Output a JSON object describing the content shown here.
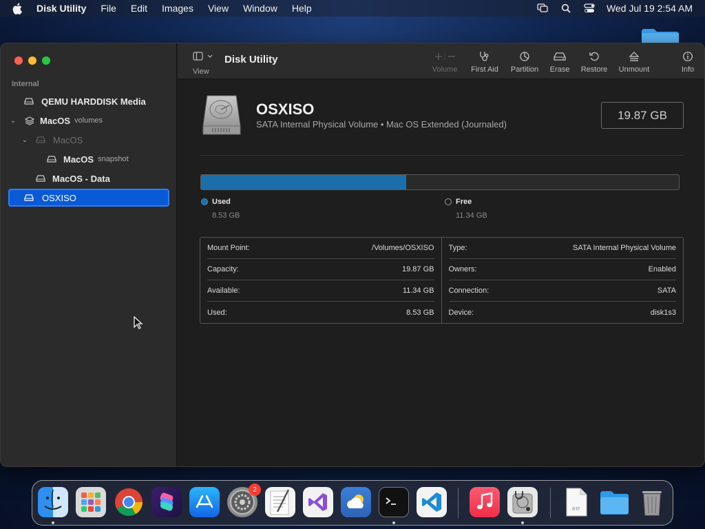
{
  "menubar": {
    "app_name": "Disk Utility",
    "items": [
      "File",
      "Edit",
      "Images",
      "View",
      "Window",
      "Help"
    ],
    "clock": "Wed Jul 19  2:54 AM"
  },
  "sidebar": {
    "section": "Internal",
    "items": [
      {
        "name": "QEMU HARDDISK Media",
        "sub": ""
      },
      {
        "name": "MacOS",
        "sub": "volumes"
      },
      {
        "name": "MacOS",
        "sub": ""
      },
      {
        "name": "MacOS",
        "sub": "snapshot"
      },
      {
        "name": "MacOS - Data",
        "sub": ""
      },
      {
        "name": "OSXISO",
        "sub": ""
      }
    ]
  },
  "toolbar": {
    "view_label": "View",
    "title": "Disk Utility",
    "buttons": [
      {
        "label": "Volume",
        "icon": "plus-minus-icon",
        "disabled": true
      },
      {
        "label": "First Aid",
        "icon": "stethoscope-icon"
      },
      {
        "label": "Partition",
        "icon": "pie-chart-icon"
      },
      {
        "label": "Erase",
        "icon": "eraser-icon"
      },
      {
        "label": "Restore",
        "icon": "restore-icon"
      },
      {
        "label": "Unmount",
        "icon": "eject-icon"
      },
      {
        "label": "Info",
        "icon": "info-icon"
      }
    ]
  },
  "volume": {
    "name": "OSXISO",
    "description": "SATA Internal Physical Volume • Mac OS Extended (Journaled)",
    "size": "19.87 GB",
    "used_fraction": 0.429
  },
  "legend": {
    "used_label": "Used",
    "used_value": "8.53 GB",
    "free_label": "Free",
    "free_value": "11.34 GB",
    "used_color": "#1b6ea9"
  },
  "info": {
    "left": [
      {
        "label": "Mount Point:",
        "value": "/Volumes/OSXISO"
      },
      {
        "label": "Capacity:",
        "value": "19.87 GB"
      },
      {
        "label": "Available:",
        "value": "11.34 GB"
      },
      {
        "label": "Used:",
        "value": "8.53 GB"
      }
    ],
    "right": [
      {
        "label": "Type:",
        "value": "SATA Internal Physical Volume"
      },
      {
        "label": "Owners:",
        "value": "Enabled"
      },
      {
        "label": "Connection:",
        "value": "SATA"
      },
      {
        "label": "Device:",
        "value": "disk1s3"
      }
    ]
  },
  "dock": {
    "apps": [
      "finder-icon",
      "launchpad-icon",
      "chrome-icon",
      "shortcuts-icon",
      "app-store-icon",
      "system-settings-icon",
      "textedit-icon",
      "visual-studio-icon",
      "weather-icon",
      "terminal-icon",
      "vscode-icon",
      "music-icon",
      "disk-utility-icon",
      "document-icon",
      "folder-icon",
      "trash-icon"
    ],
    "settings_badge": "2",
    "document_label": "RTF"
  }
}
